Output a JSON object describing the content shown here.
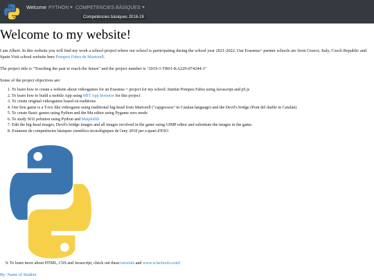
{
  "nav": {
    "items": [
      "Welcome",
      "PYTHON",
      "COMPETENCIES BÀSIQUES"
    ],
    "dropdown_item": "Competències bàsiques 2018-19"
  },
  "main": {
    "title": "Welcome to my website!",
    "intro_text": "I am Albert. In this website you will find my work a school project where our school is participating during the school year 2021-2022. Our Erasmus+ partner schools are from Greece, Italy, Czech Republic and Spain Visit school website here ",
    "intro_link": "Pompeu Fabra de Martorell",
    "intro_end": ".",
    "project_title_text": "The project title is \"Touching the past to reach the future\" and the project number is \"2019-1-TR01-KA229-074244-1\"",
    "objectives_heading": "Some of the project objectives are:",
    "objectives": [
      {
        "text": "To learn how to create a website about videogames for an Erasmus + project for my school: Institut Pompeu Fabra using Javascript and p5.js",
        "link": "",
        "after": ""
      },
      {
        "text": "To learn how to build a mobile App using ",
        "link": "MIT App Inventor",
        "after": " for this project"
      },
      {
        "text": "To create original videogames based on traditions",
        "link": "",
        "after": ""
      },
      {
        "text": "Our first game is a T-rex like videogame using traditional big-head from Martorell (\"capgrossos\" in Catalan language) and the Devil's bridge (Pont del diable in Catalán)",
        "link": "",
        "after": ""
      },
      {
        "text": "To create Basic games using Python and the Mu editor using Pygame zero mode",
        "link": "",
        "after": ""
      },
      {
        "text": "To study SO2 polution using Python and ",
        "link": "Matplotlib",
        "after": ""
      },
      {
        "text": "Edit the big-head images, Devil's bridge images and all images involved in the game using GIMP editor and substitute the images in the game.",
        "link": "",
        "after": ""
      },
      {
        "text": "Exàmens de competències bàsiques científico-tecnològiques de l'any 2018 per a quart d'ESO",
        "link": "",
        "after": ""
      }
    ],
    "item9": {
      "num": "9.",
      "text": "To learn more about HTML, CSS and Javascript, check out these ",
      "link1": "tutorials",
      "mid": " and ",
      "link2": "www.w3schools.com",
      "end": "!"
    }
  },
  "footer": {
    "text": "By: Name of Student"
  },
  "icons": {
    "brand": "python-logo-icon",
    "main_image": "python-logo-image"
  },
  "colors": {
    "navbar": "#343a40",
    "link": "#1e7bd6",
    "python_blue": "#3a75b0",
    "python_yellow": "#f7d04a"
  }
}
